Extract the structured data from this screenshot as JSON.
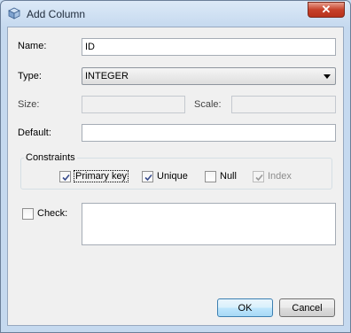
{
  "window": {
    "title": "Add Column",
    "icon": "database-cube-icon",
    "close_glyph": "✕"
  },
  "form": {
    "name_label": "Name:",
    "name_value": "ID",
    "type_label": "Type:",
    "type_value": "INTEGER",
    "size_label": "Size:",
    "size_value": "",
    "scale_label": "Scale:",
    "scale_value": "",
    "default_label": "Default:",
    "default_value": ""
  },
  "constraints": {
    "title": "Constraints",
    "primary_key": {
      "label": "Primary key",
      "checked": true
    },
    "unique": {
      "label": "Unique",
      "checked": true
    },
    "null": {
      "label": "Null",
      "checked": false
    },
    "index": {
      "label": "Index",
      "checked": true,
      "disabled": true
    }
  },
  "check": {
    "label": "Check:",
    "checked": false,
    "value": ""
  },
  "buttons": {
    "ok": "OK",
    "cancel": "Cancel"
  }
}
